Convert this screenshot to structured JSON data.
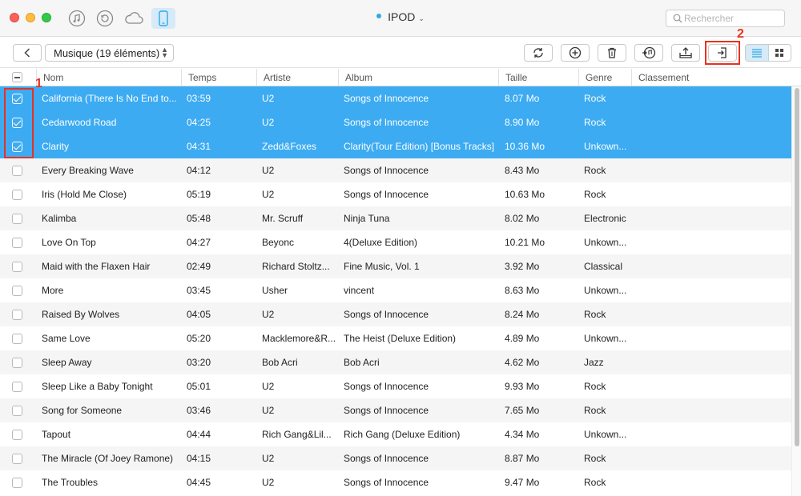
{
  "window": {
    "device_name": "IPOD",
    "search_placeholder": "Rechercher"
  },
  "toolbar": {
    "category": "Musique (19 éléments)"
  },
  "annotations": {
    "marker1": "1",
    "marker2": "2"
  },
  "columns": [
    "Nom",
    "Temps",
    "Artiste",
    "Album",
    "Taille",
    "Genre",
    "Classement"
  ],
  "rows": [
    {
      "name": "California (There Is No End to...",
      "time": "03:59",
      "artist": "U2",
      "album": "Songs of Innocence",
      "size": "8.07 Mo",
      "genre": "Rock",
      "selected": true
    },
    {
      "name": "Cedarwood Road",
      "time": "04:25",
      "artist": "U2",
      "album": "Songs of Innocence",
      "size": "8.90 Mo",
      "genre": "Rock",
      "selected": true
    },
    {
      "name": "Clarity",
      "time": "04:31",
      "artist": "Zedd&Foxes",
      "album": "Clarity(Tour Edition) [Bonus Tracks]",
      "size": "10.36 Mo",
      "genre": "Unkown...",
      "selected": true
    },
    {
      "name": "Every Breaking Wave",
      "time": "04:12",
      "artist": "U2",
      "album": "Songs of Innocence",
      "size": "8.43 Mo",
      "genre": "Rock",
      "selected": false
    },
    {
      "name": "Iris (Hold Me Close)",
      "time": "05:19",
      "artist": "U2",
      "album": "Songs of Innocence",
      "size": "10.63 Mo",
      "genre": "Rock",
      "selected": false
    },
    {
      "name": "Kalimba",
      "time": "05:48",
      "artist": "Mr. Scruff",
      "album": "Ninja Tuna",
      "size": "8.02 Mo",
      "genre": "Electronic",
      "selected": false
    },
    {
      "name": "Love On Top",
      "time": "04:27",
      "artist": "Beyonc",
      "album": "4(Deluxe Edition)",
      "size": "10.21 Mo",
      "genre": "Unkown...",
      "selected": false
    },
    {
      "name": "Maid with the Flaxen Hair",
      "time": "02:49",
      "artist": "Richard Stoltz...",
      "album": "Fine Music, Vol. 1",
      "size": "3.92 Mo",
      "genre": "Classical",
      "selected": false
    },
    {
      "name": "More",
      "time": "03:45",
      "artist": "Usher",
      "album": "vincent",
      "size": "8.63 Mo",
      "genre": "Unkown...",
      "selected": false
    },
    {
      "name": "Raised By Wolves",
      "time": "04:05",
      "artist": "U2",
      "album": "Songs of Innocence",
      "size": "8.24 Mo",
      "genre": "Rock",
      "selected": false
    },
    {
      "name": "Same Love",
      "time": "05:20",
      "artist": "Macklemore&R...",
      "album": "The Heist (Deluxe Edition)",
      "size": "4.89 Mo",
      "genre": "Unkown...",
      "selected": false
    },
    {
      "name": "Sleep Away",
      "time": "03:20",
      "artist": "Bob Acri",
      "album": "Bob Acri",
      "size": "4.62 Mo",
      "genre": "Jazz",
      "selected": false
    },
    {
      "name": "Sleep Like a Baby Tonight",
      "time": "05:01",
      "artist": "U2",
      "album": "Songs of Innocence",
      "size": "9.93 Mo",
      "genre": "Rock",
      "selected": false
    },
    {
      "name": "Song for Someone",
      "time": "03:46",
      "artist": "U2",
      "album": "Songs of Innocence",
      "size": "7.65 Mo",
      "genre": "Rock",
      "selected": false
    },
    {
      "name": "Tapout",
      "time": "04:44",
      "artist": "Rich Gang&Lil...",
      "album": "Rich Gang (Deluxe Edition)",
      "size": "4.34 Mo",
      "genre": "Unkown...",
      "selected": false
    },
    {
      "name": "The Miracle (Of Joey Ramone)",
      "time": "04:15",
      "artist": "U2",
      "album": "Songs of Innocence",
      "size": "8.87 Mo",
      "genre": "Rock",
      "selected": false
    },
    {
      "name": "The Troubles",
      "time": "04:45",
      "artist": "U2",
      "album": "Songs of Innocence",
      "size": "9.47 Mo",
      "genre": "Rock",
      "selected": false
    }
  ],
  "colors": {
    "selection": "#3cabf2",
    "annotation": "#e8321f",
    "accent": "#2ca9e8"
  }
}
